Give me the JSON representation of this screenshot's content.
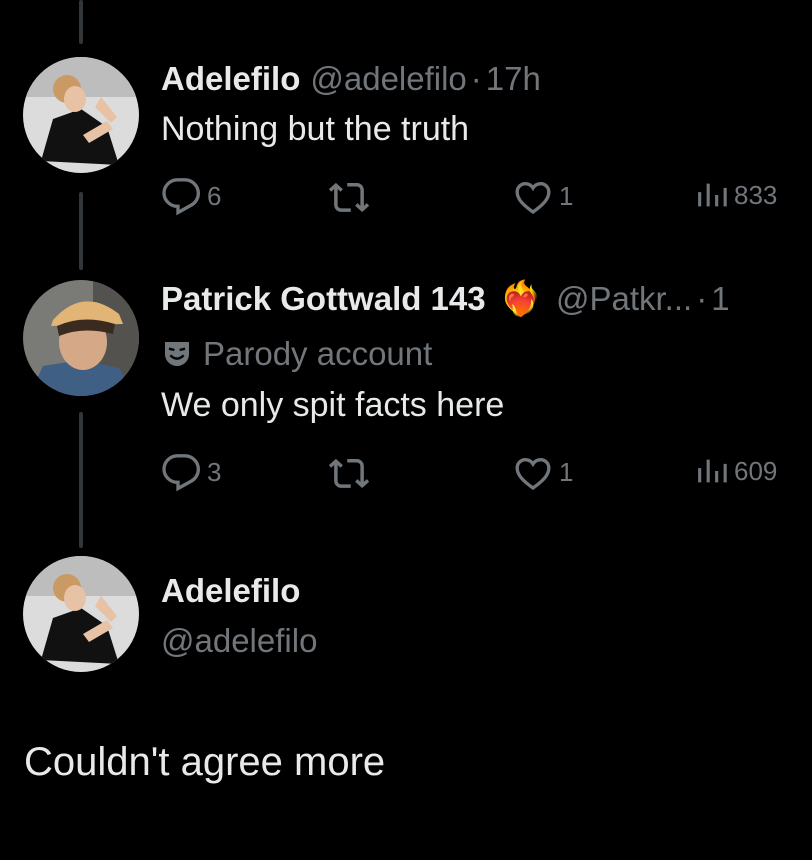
{
  "tweets": [
    {
      "name": "Adelefilo",
      "handle": "@adelefilo",
      "separator": "·",
      "time": "17h",
      "text": "Nothing but the truth",
      "stats": {
        "replies": "6",
        "likes": "1",
        "views": "833"
      }
    },
    {
      "name": "Patrick Gottwald 143",
      "emoji": "❤️‍🔥",
      "handle": "@Patkr...",
      "separator": "·",
      "time_partial": "1",
      "badge": "Parody account",
      "text": "We only spit facts here",
      "stats": {
        "replies": "3",
        "likes": "1",
        "views": "609"
      }
    }
  ],
  "reply": {
    "name": "Adelefilo",
    "handle": "@adelefilo",
    "text": "Couldn't agree more"
  },
  "colors": {
    "background": "#000000",
    "primary_text": "#e7e9ea",
    "secondary_text": "#71767b",
    "thread_line": "#333639",
    "heart_fire": "#e0245e"
  },
  "icons": [
    "reply-icon",
    "retweet-icon",
    "like-icon",
    "views-icon",
    "parody-mask-icon"
  ]
}
